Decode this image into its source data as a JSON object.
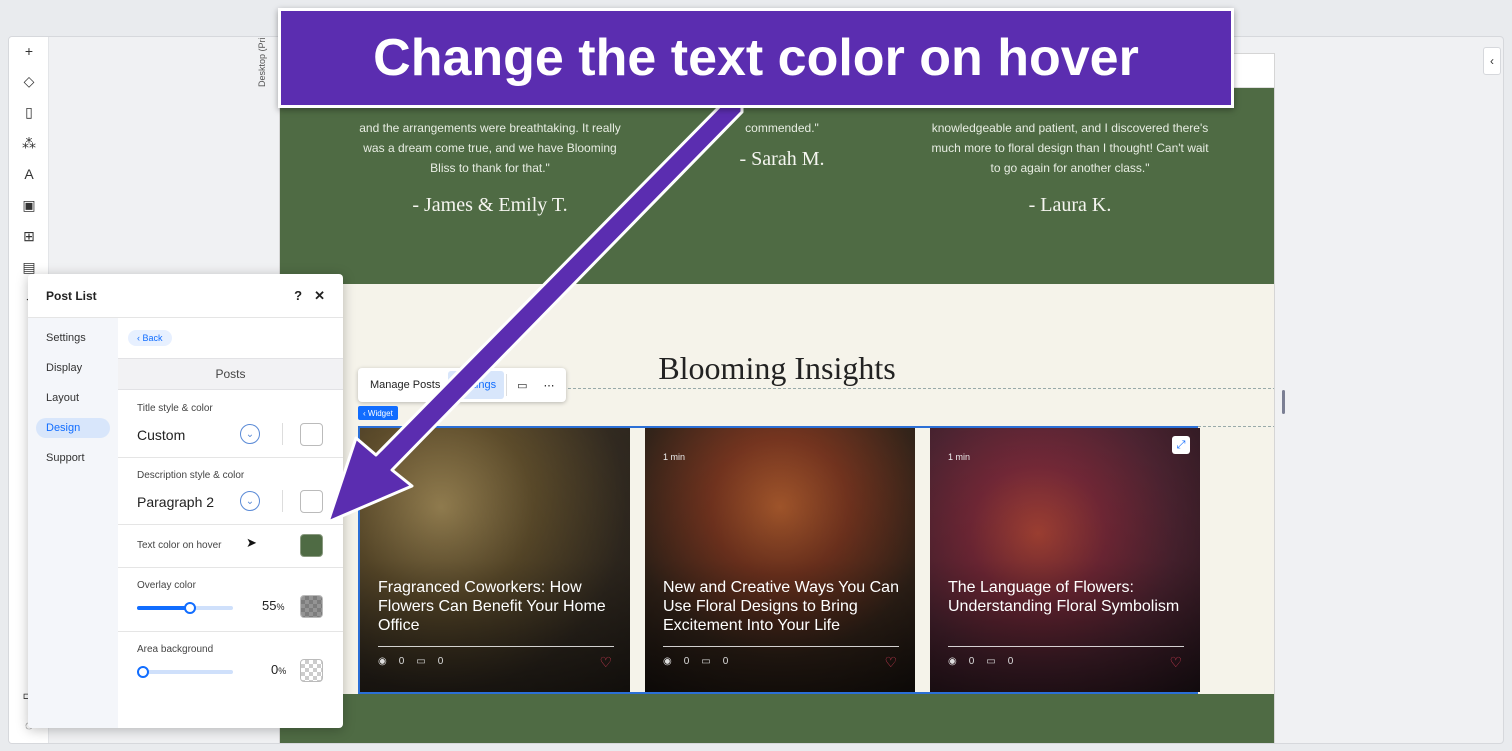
{
  "banner": {
    "text": "Change the text color on hover"
  },
  "editor": {
    "view_label": "Desktop (Primary)",
    "rail_icons": [
      "plus-icon",
      "layers-icon",
      "page-icon",
      "components-icon",
      "text-style-icon",
      "image-icon",
      "apps-icon",
      "table-icon",
      "code-icon",
      "chat-icon",
      "help-icon"
    ]
  },
  "testimonials": [
    {
      "quote": "and the arrangements were breathtaking. It really was a dream come true, and we have Blooming Bliss to thank for that.\"",
      "name": "- James & Emily T."
    },
    {
      "quote": "commended.\"",
      "name": "- Sarah M."
    },
    {
      "quote": "knowledgeable and patient, and I discovered there's much more to floral design than I thought! Can't wait to go again for another class.\"",
      "name": "- Laura K."
    }
  ],
  "blog": {
    "title": "Blooming Insights",
    "toolbar": {
      "manage": "Manage Posts",
      "settings": "Settings",
      "more": "⋯"
    },
    "widget_tag": "Widget",
    "cards": [
      {
        "mins": "",
        "title": "Fragranced Coworkers: How Flowers Can Benefit Your Home Office",
        "views": "0",
        "comments": "0"
      },
      {
        "mins": "1 min",
        "title": "New and Creative Ways You Can Use Floral Designs to Bring Excitement Into Your Life",
        "views": "0",
        "comments": "0"
      },
      {
        "mins": "1 min",
        "title": "The Language of Flowers: Understanding Floral Symbolism",
        "views": "0",
        "comments": "0"
      }
    ]
  },
  "panel": {
    "title": "Post List",
    "help": "?",
    "close": "✕",
    "nav": [
      "Settings",
      "Display",
      "Layout",
      "Design",
      "Support"
    ],
    "back": "Back",
    "section": "Posts",
    "title_style": {
      "label": "Title style & color",
      "value": "Custom"
    },
    "desc_style": {
      "label": "Description style & color",
      "value": "Paragraph 2"
    },
    "hover_color": {
      "label": "Text color on hover",
      "color": "#4f6b44"
    },
    "overlay": {
      "label": "Overlay color",
      "value": 55,
      "unit": "%",
      "number": "55"
    },
    "area_bg": {
      "label": "Area background",
      "value": 0,
      "unit": "%",
      "number": "0"
    }
  },
  "colors": {
    "accent": "#116dff",
    "banner": "#5b2db0",
    "site_green": "#4f6b44",
    "site_cream": "#f5f3ea"
  }
}
